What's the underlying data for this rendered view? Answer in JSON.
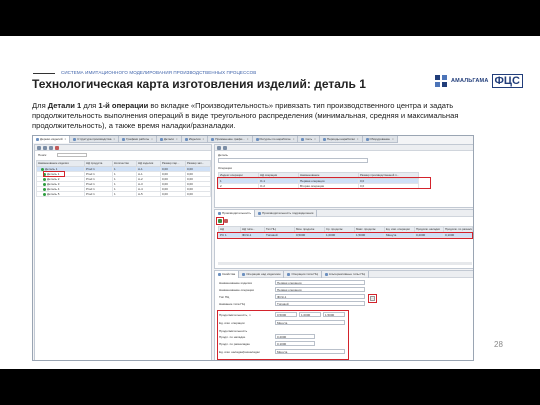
{
  "header": {
    "kicker": "СИСТЕМА ИМИТАЦИОННОГО МОДЕЛИРОВАНИЯ ПРОИЗВОДСТВЕННЫХ ПРОЦЕССОВ",
    "title": "Технологическая карта изготовления изделий: деталь 1",
    "desc_part1": "Для ",
    "desc_bold1": "Детали 1",
    "desc_part2": " для ",
    "desc_bold2": "1-й операции",
    "desc_part3": " во вкладке «Производительность» привязать тип производственного центра и задать продолжительность выполнения операций в виде треугольного распределения (минимальная, средняя и максимальная продолжительность), а также время наладки/разналадки."
  },
  "logo": {
    "brand": "АМАЛЬГАМА",
    "fcs": "ФЦС",
    "mark_color": "#213d7a"
  },
  "page_number": "28",
  "app": {
    "tabs": [
      {
        "label": "Дерево изделий",
        "active": true
      },
      {
        "label": "Структура производства"
      },
      {
        "label": "Графики работы"
      },
      {
        "label": "Детали"
      },
      {
        "label": "Изделия"
      },
      {
        "label": "Применение графи..."
      },
      {
        "label": "Ресурсы по наработке"
      },
      {
        "label": "Сеть"
      },
      {
        "label": "Периоды наработки"
      },
      {
        "label": "Оборудование"
      }
    ],
    "left": {
      "search_label": "Поиск",
      "columns": [
        "Наименование изделия",
        "НД продукта",
        "Количество",
        "НД изделия",
        "Размер пар...",
        "Размер зап..."
      ],
      "rows": [
        {
          "name": "Деталь 1",
          "nd": "Prod 1",
          "qty": "1",
          "ndi": "А-1",
          "s1": "0,00",
          "s2": "0,00",
          "selected": true
        },
        {
          "name": "Деталь 1",
          "nd": "Prod 1",
          "qty": "1",
          "ndi": "А-1",
          "s1": "0,00",
          "s2": "0,00"
        },
        {
          "name": "Деталь 2",
          "nd": "Prod 1",
          "qty": "1",
          "ndi": "А-2",
          "s1": "0,00",
          "s2": "0,00"
        },
        {
          "name": "Деталь 3",
          "nd": "Prod 1",
          "qty": "1",
          "ndi": "А-3",
          "s1": "0,00",
          "s2": "0,00"
        },
        {
          "name": "Деталь 4",
          "nd": "Prod 1",
          "qty": "1",
          "ndi": "А-4",
          "s1": "0,00",
          "s2": "0,00"
        },
        {
          "name": "Деталь 5",
          "nd": "Prod 1",
          "qty": "1",
          "ndi": "А-5",
          "s1": "0,00",
          "s2": "0,00"
        }
      ]
    },
    "ops": {
      "detail_label": "Деталь",
      "ops_label": "Операции",
      "columns": [
        "Индекс операции",
        "НД операции",
        "Наименование",
        "Размер производственной п..."
      ],
      "rows": [
        {
          "idx": "1",
          "nd": "О-1",
          "name": "Первая операция",
          "size": "0,0"
        },
        {
          "idx": "2",
          "nd": "О-2",
          "name": "Вторая операция",
          "size": "0,0"
        }
      ]
    },
    "prod": {
      "tabs": [
        "Производительность",
        "Производительность подразделения"
      ],
      "columns": [
        "НД",
        "НД типа...",
        "Тип ПЦ",
        "Мин. продолж.",
        "Ср. продолж.",
        "Макс. продолж.",
        "Ед. изм. операции",
        "Продолж. наладки",
        "Продолж. по разналадке"
      ],
      "row": {
        "nd": "PC 1",
        "ndt": "ФСЭ-1",
        "type": "Типовой",
        "min": "0,5000",
        "avg": "1,0000",
        "max": "1,5000",
        "unit": "Минута",
        "setup": "0,2000",
        "unsetup": "0,1000"
      }
    },
    "props": {
      "tabs": [
        "Свойства",
        "Операции над изделием",
        "Операции типа ПЦ",
        "Альтернативные типы ПЦ"
      ],
      "fields": [
        {
          "label": "Наименование изделия",
          "value": "Первая операция"
        },
        {
          "label": "Наименование операции",
          "value": "Первая операция"
        },
        {
          "label": "Тип ПЦ",
          "value": "ФСЭ-1"
        },
        {
          "label": "Название типа ПЦ",
          "value": "Типовой"
        }
      ],
      "dur_label": "Продолжительность, ч",
      "dur_values": [
        "0,5000",
        "1,0000",
        "1,5000"
      ],
      "unit_label": "Ед. изм. операции",
      "unit_value": "Минута",
      "setup_label": "Продолжительность",
      "setup_sub1": "Продл. по наладке",
      "setup_val1": "0,2000",
      "setup_sub2": "Продл. по разналадке",
      "setup_val2": "0,1000",
      "unit2_label": "Ед. изм. наладки/разналадки",
      "unit2_value": "Минута"
    }
  }
}
